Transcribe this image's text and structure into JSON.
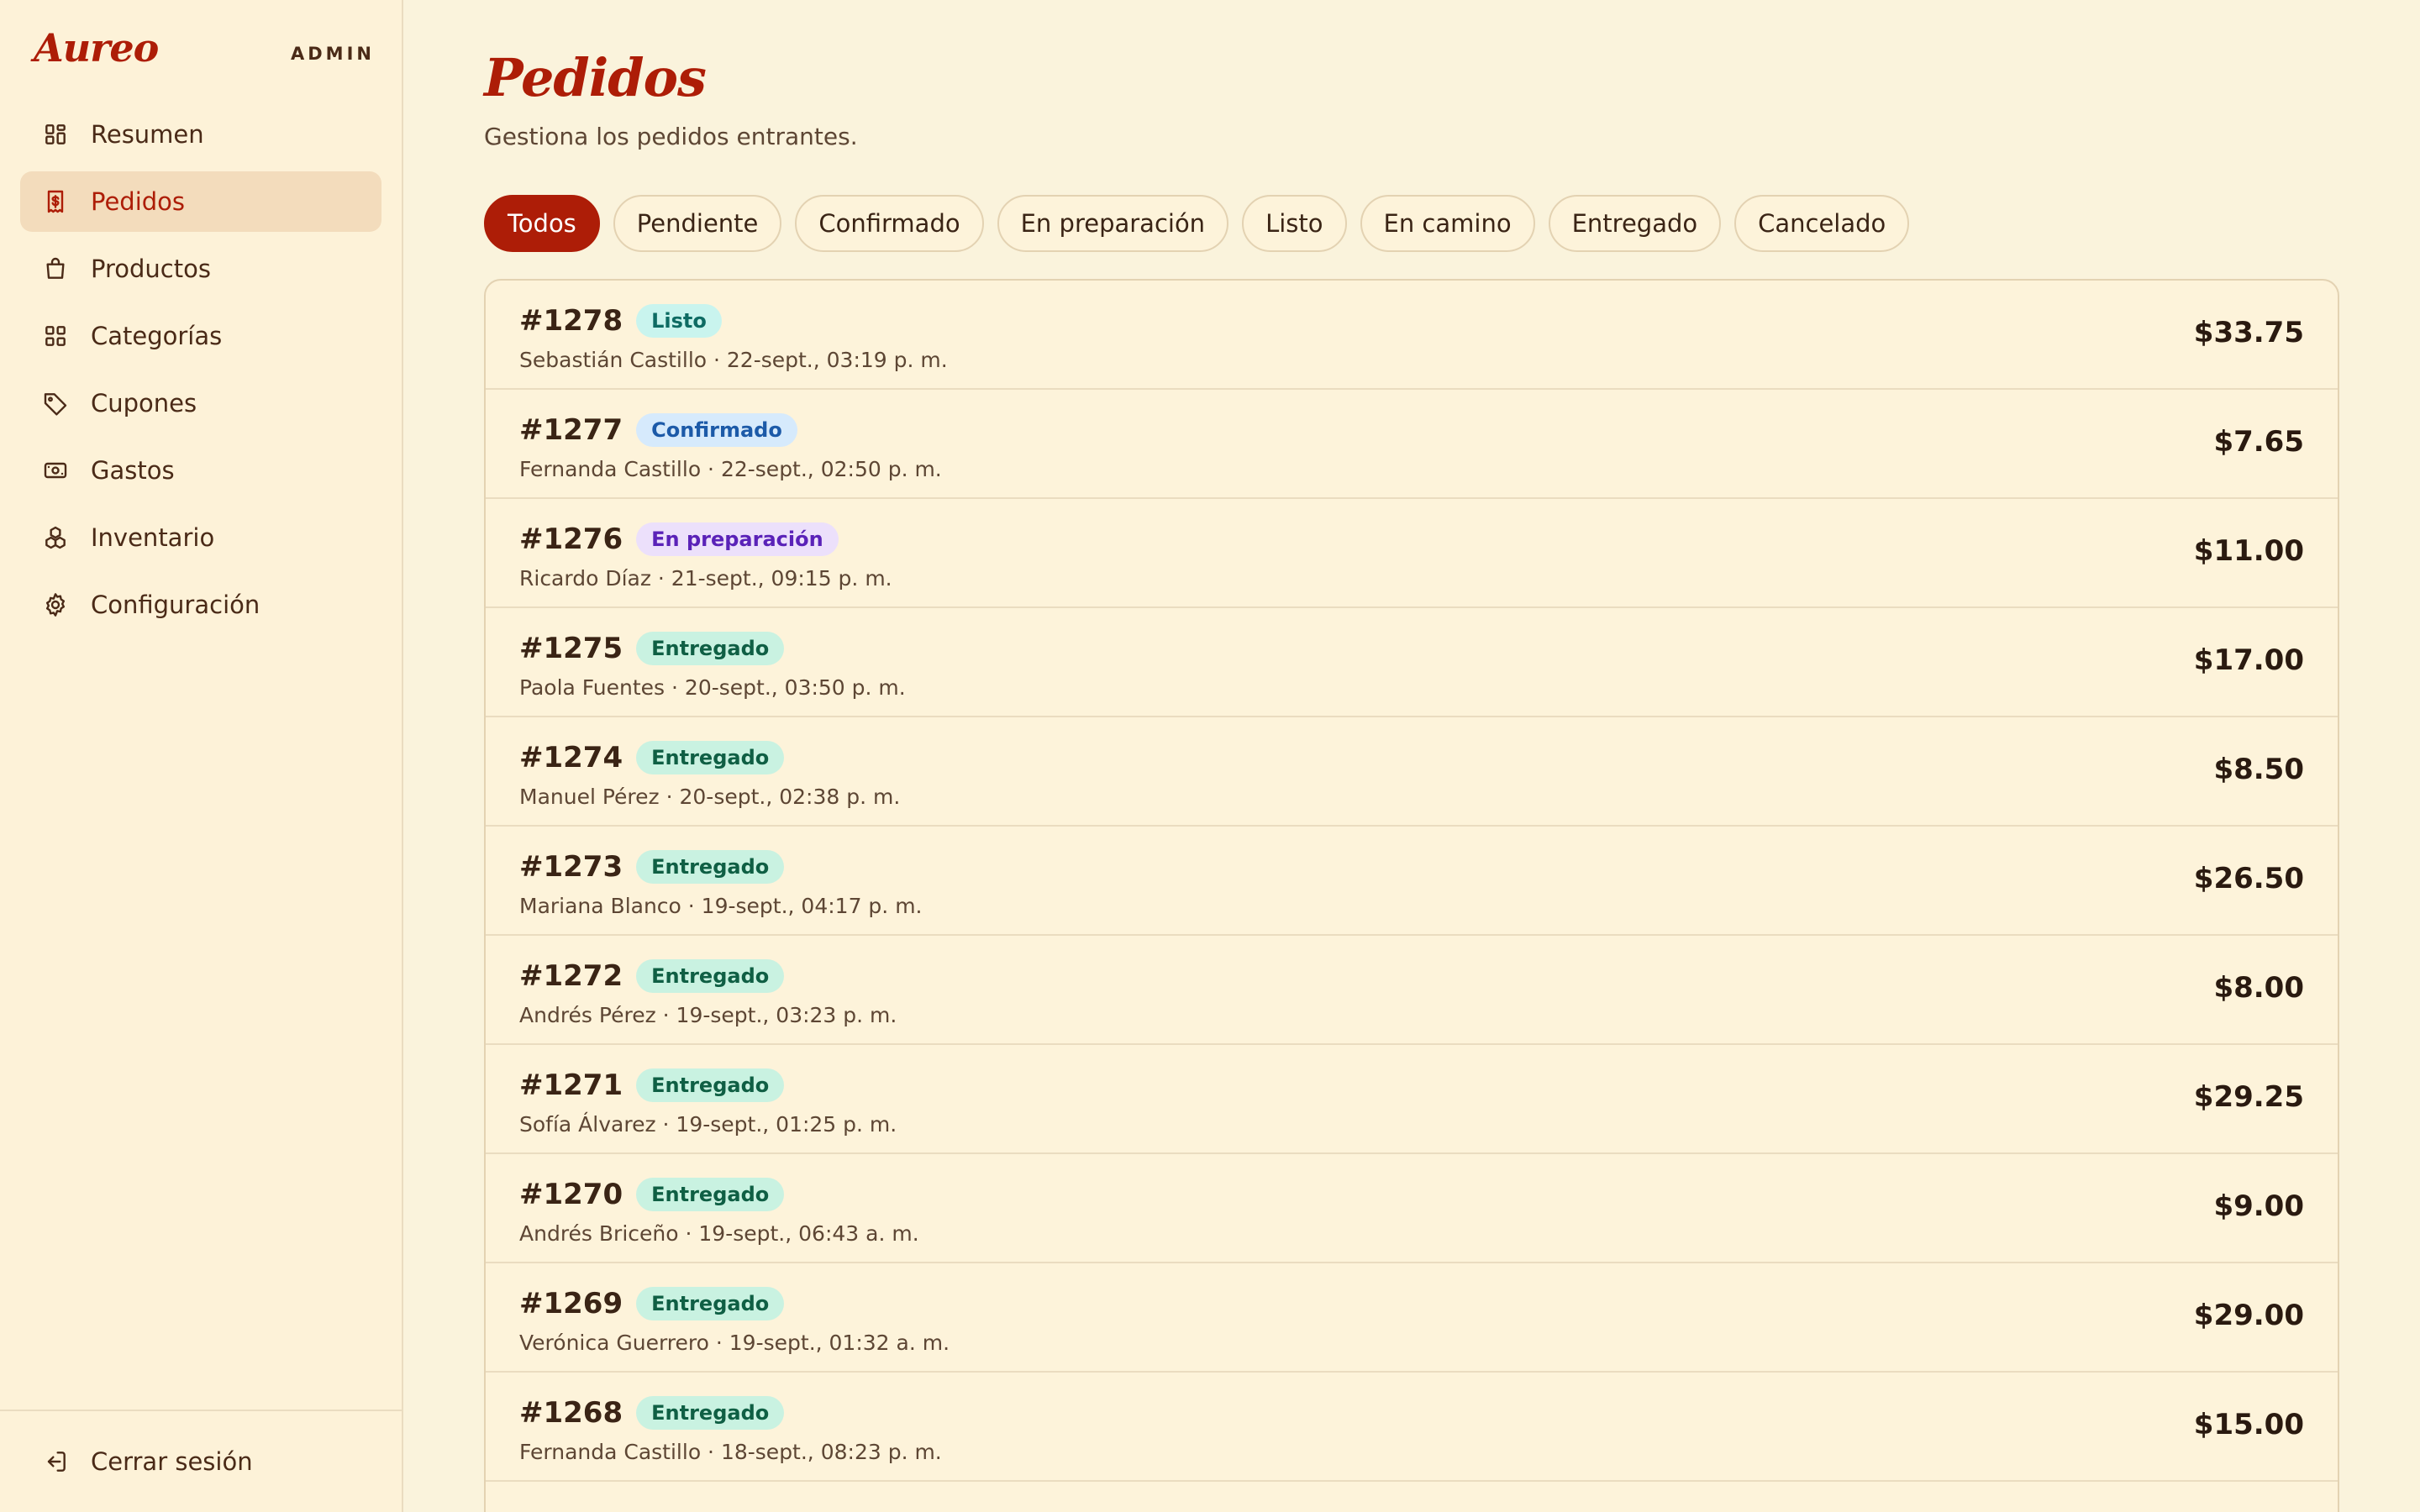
{
  "brand": {
    "name": "Aureo",
    "tag": "ADMIN"
  },
  "sidebar": {
    "items": [
      {
        "label": "Resumen",
        "icon": "dashboard-icon",
        "active": false
      },
      {
        "label": "Pedidos",
        "icon": "receipt-icon",
        "active": true
      },
      {
        "label": "Productos",
        "icon": "bag-icon",
        "active": false
      },
      {
        "label": "Categorías",
        "icon": "grid-icon",
        "active": false
      },
      {
        "label": "Cupones",
        "icon": "tag-icon",
        "active": false
      },
      {
        "label": "Gastos",
        "icon": "banknote-icon",
        "active": false
      },
      {
        "label": "Inventario",
        "icon": "boxes-icon",
        "active": false
      },
      {
        "label": "Configuración",
        "icon": "gear-icon",
        "active": false
      }
    ],
    "logout_label": "Cerrar sesión"
  },
  "page": {
    "title": "Pedidos",
    "subtitle": "Gestiona los pedidos entrantes."
  },
  "filters": [
    {
      "label": "Todos",
      "active": true
    },
    {
      "label": "Pendiente",
      "active": false
    },
    {
      "label": "Confirmado",
      "active": false
    },
    {
      "label": "En preparación",
      "active": false
    },
    {
      "label": "Listo",
      "active": false
    },
    {
      "label": "En camino",
      "active": false
    },
    {
      "label": "Entregado",
      "active": false
    },
    {
      "label": "Cancelado",
      "active": false
    }
  ],
  "status_colors": {
    "Listo": {
      "bg": "#c9f4ee",
      "fg": "#0e6b63"
    },
    "Confirmado": {
      "bg": "#d6eafc",
      "fg": "#1c5aa8"
    },
    "En preparación": {
      "bg": "#ece0fb",
      "fg": "#5a22b8"
    },
    "Entregado": {
      "bg": "#c9f2e1",
      "fg": "#0f5f44"
    }
  },
  "orders": [
    {
      "id": "#1278",
      "status": "Listo",
      "meta": "Sebastián Castillo · 22-sept., 03:19 p. m.",
      "total": "$33.75"
    },
    {
      "id": "#1277",
      "status": "Confirmado",
      "meta": "Fernanda Castillo · 22-sept., 02:50 p. m.",
      "total": "$7.65"
    },
    {
      "id": "#1276",
      "status": "En preparación",
      "meta": "Ricardo Díaz · 21-sept., 09:15 p. m.",
      "total": "$11.00"
    },
    {
      "id": "#1275",
      "status": "Entregado",
      "meta": "Paola Fuentes · 20-sept., 03:50 p. m.",
      "total": "$17.00"
    },
    {
      "id": "#1274",
      "status": "Entregado",
      "meta": "Manuel Pérez · 20-sept., 02:38 p. m.",
      "total": "$8.50"
    },
    {
      "id": "#1273",
      "status": "Entregado",
      "meta": "Mariana Blanco · 19-sept., 04:17 p. m.",
      "total": "$26.50"
    },
    {
      "id": "#1272",
      "status": "Entregado",
      "meta": "Andrés Pérez · 19-sept., 03:23 p. m.",
      "total": "$8.00"
    },
    {
      "id": "#1271",
      "status": "Entregado",
      "meta": "Sofía Álvarez · 19-sept., 01:25 p. m.",
      "total": "$29.25"
    },
    {
      "id": "#1270",
      "status": "Entregado",
      "meta": "Andrés Briceño · 19-sept., 06:43 a. m.",
      "total": "$9.00"
    },
    {
      "id": "#1269",
      "status": "Entregado",
      "meta": "Verónica Guerrero · 19-sept., 01:32 a. m.",
      "total": "$29.00"
    },
    {
      "id": "#1268",
      "status": "Entregado",
      "meta": "Fernanda Castillo · 18-sept., 08:23 p. m.",
      "total": "$15.00"
    }
  ]
}
